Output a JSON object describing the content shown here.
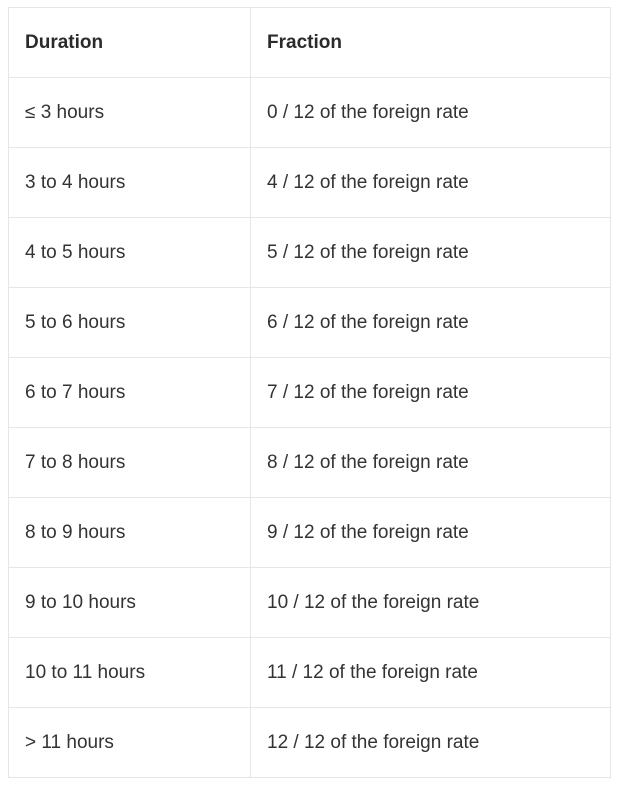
{
  "table": {
    "columns": [
      {
        "key": "duration",
        "label": "Duration"
      },
      {
        "key": "fraction",
        "label": "Fraction"
      }
    ],
    "rows": [
      {
        "duration": "≤ 3 hours",
        "fraction": "0 / 12 of the foreign rate"
      },
      {
        "duration": "3 to 4 hours",
        "fraction": "4 / 12 of the foreign rate"
      },
      {
        "duration": "4 to 5 hours",
        "fraction": "5 / 12 of the foreign rate"
      },
      {
        "duration": "5 to 6 hours",
        "fraction": "6 / 12 of the foreign rate"
      },
      {
        "duration": "6 to 7 hours",
        "fraction": "7 / 12 of the foreign rate"
      },
      {
        "duration": "7 to 8 hours",
        "fraction": "8 / 12 of the foreign rate"
      },
      {
        "duration": "8 to 9 hours",
        "fraction": "9 / 12 of the foreign rate"
      },
      {
        "duration": "9 to 10 hours",
        "fraction": "10 / 12 of the foreign rate"
      },
      {
        "duration": "10 to 11 hours",
        "fraction": "11 / 12 of the foreign rate"
      },
      {
        "duration": "> 11 hours",
        "fraction": "12 / 12 of the foreign rate"
      }
    ]
  },
  "colors": {
    "border": "#e6e6e6",
    "text": "#333333",
    "header_text": "#2b2b2b",
    "background": "#ffffff"
  }
}
